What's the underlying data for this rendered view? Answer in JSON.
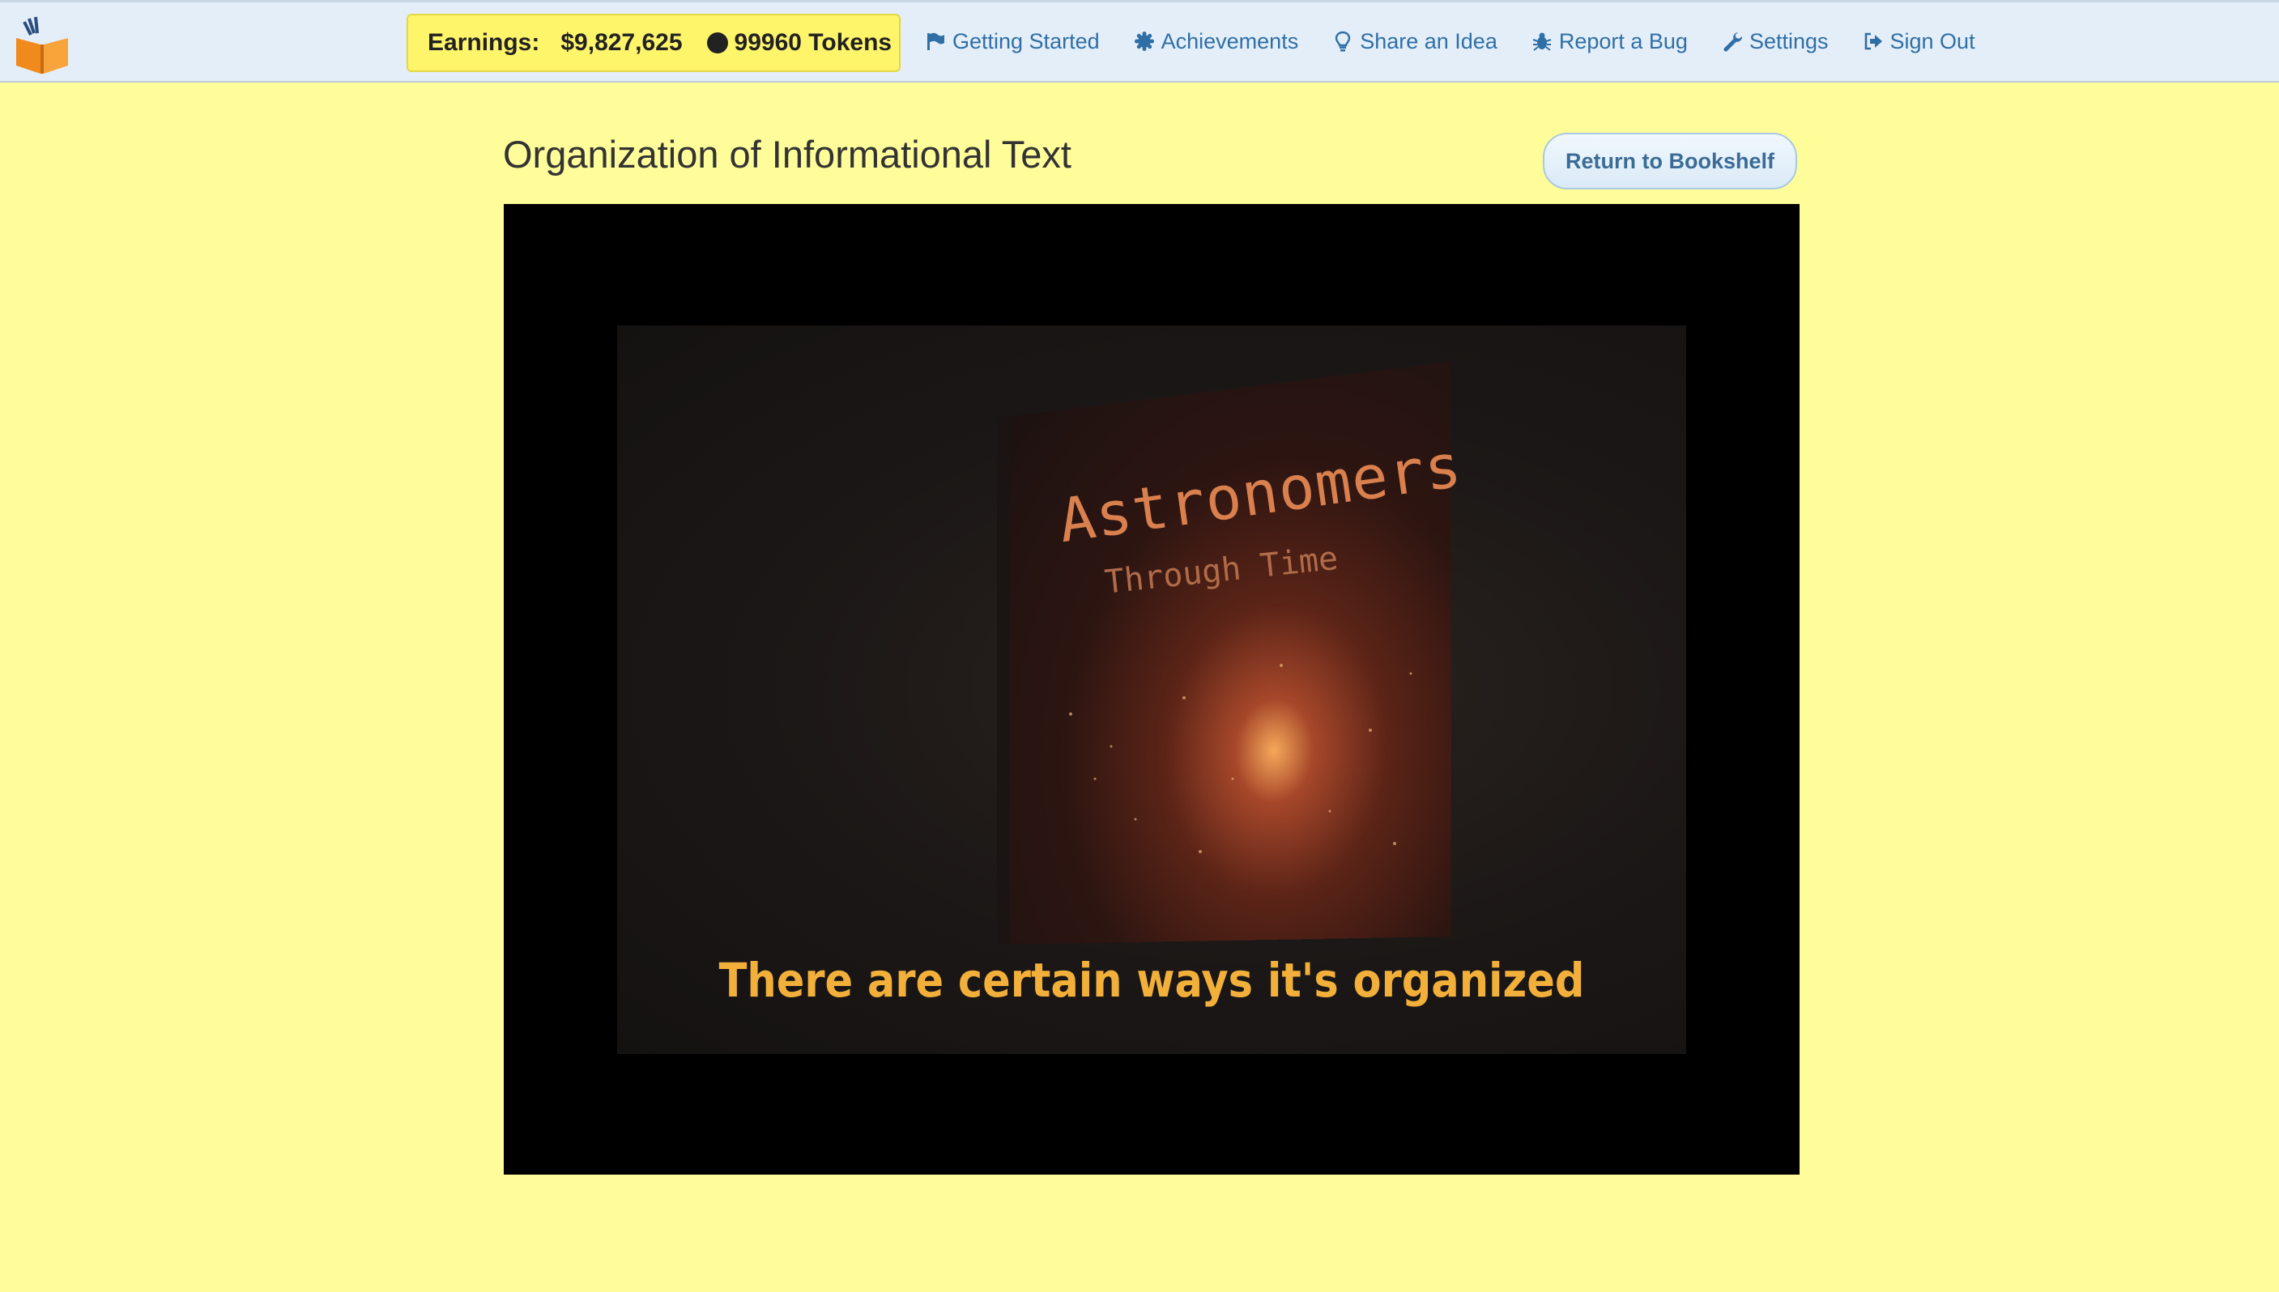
{
  "header": {
    "earnings_label": "Earnings:",
    "earnings_value": "$9,827,625",
    "tokens_value": "99960 Tokens",
    "nav": [
      {
        "label": "Getting Started",
        "icon": "flag-icon"
      },
      {
        "label": "Achievements",
        "icon": "badge-icon"
      },
      {
        "label": "Share an Idea",
        "icon": "lightbulb-icon"
      },
      {
        "label": "Report a Bug",
        "icon": "bug-icon"
      },
      {
        "label": "Settings",
        "icon": "wrench-icon"
      },
      {
        "label": "Sign Out",
        "icon": "sign-out-icon"
      }
    ]
  },
  "main": {
    "title": "Organization of Informational Text",
    "return_label": "Return to Bookshelf",
    "video": {
      "book_title": "Astronomers",
      "book_subtitle": "Through Time",
      "caption": "There are certain ways it's organized"
    }
  },
  "colors": {
    "page_bg": "#FFFD99",
    "navbar_bg": "#E4EEF8",
    "earnings_bg": "#FFF56A",
    "link": "#2F6FA6",
    "caption": "#F2B03A"
  }
}
